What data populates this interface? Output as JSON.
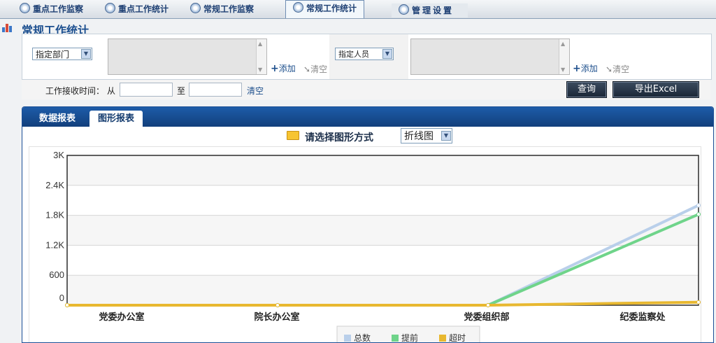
{
  "nav": {
    "tabs": [
      {
        "label": "重点工作监察",
        "active": false
      },
      {
        "label": "重点工作统计",
        "active": false
      },
      {
        "label": "常规工作监察",
        "active": false
      },
      {
        "label": "常规工作统计",
        "active": true
      },
      {
        "label": "管理设置",
        "active": false
      }
    ]
  },
  "page": {
    "title": "常规工作统计"
  },
  "filters": {
    "dept_select": "指定部门",
    "person_select": "指定人员",
    "add_label": "添加",
    "clear_label": "清空",
    "time_label": "工作接收时间：",
    "from_label": "从",
    "to_label": "至",
    "time_clear": "清空",
    "query_button": "查询",
    "export_button": "导出Excel"
  },
  "panel": {
    "tabs": [
      "数据报表",
      "图形报表"
    ],
    "active_tab": "图形报表",
    "chooser_label": "请选择图形方式",
    "chart_type_value": "折线图"
  },
  "chart_data": {
    "type": "line",
    "categories": [
      "党委办公室",
      "院长办公室",
      "党委组织部",
      "纪委监察处"
    ],
    "ylim": [
      0,
      3000
    ],
    "yticks": [
      "0",
      "600",
      "1.2K",
      "1.8K",
      "2.4K",
      "3K"
    ],
    "series": [
      {
        "name": "总数",
        "color": "#b9cfea",
        "values": [
          0,
          0,
          0,
          2000
        ]
      },
      {
        "name": "提前",
        "color": "#6fd48a",
        "values": [
          0,
          0,
          0,
          1820
        ]
      },
      {
        "name": "超时",
        "color": "#e8b830",
        "values": [
          0,
          0,
          0,
          60
        ]
      }
    ]
  }
}
